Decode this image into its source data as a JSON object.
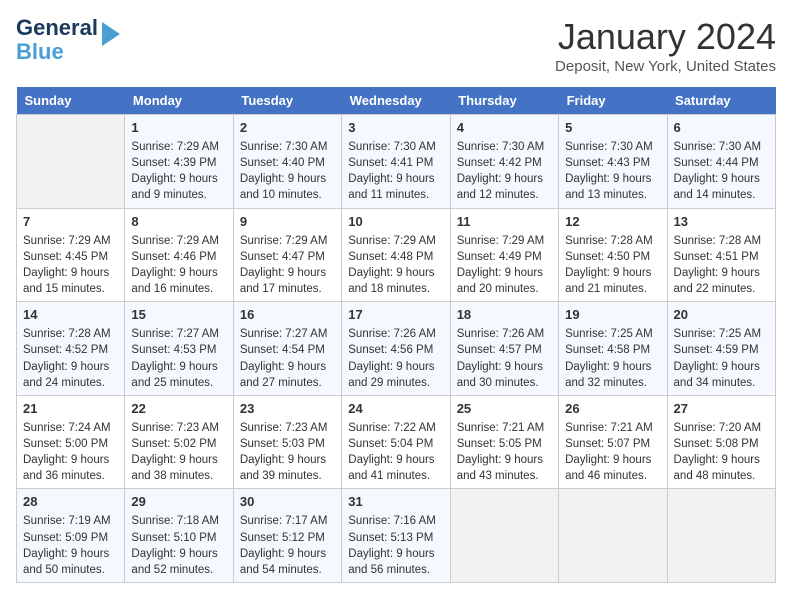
{
  "header": {
    "logo_line1": "General",
    "logo_line2": "Blue",
    "title": "January 2024",
    "subtitle": "Deposit, New York, United States"
  },
  "days_of_week": [
    "Sunday",
    "Monday",
    "Tuesday",
    "Wednesday",
    "Thursday",
    "Friday",
    "Saturday"
  ],
  "weeks": [
    [
      {
        "day": "",
        "sunrise": "",
        "sunset": "",
        "daylight": ""
      },
      {
        "day": "1",
        "sunrise": "Sunrise: 7:29 AM",
        "sunset": "Sunset: 4:39 PM",
        "daylight": "Daylight: 9 hours and 9 minutes."
      },
      {
        "day": "2",
        "sunrise": "Sunrise: 7:30 AM",
        "sunset": "Sunset: 4:40 PM",
        "daylight": "Daylight: 9 hours and 10 minutes."
      },
      {
        "day": "3",
        "sunrise": "Sunrise: 7:30 AM",
        "sunset": "Sunset: 4:41 PM",
        "daylight": "Daylight: 9 hours and 11 minutes."
      },
      {
        "day": "4",
        "sunrise": "Sunrise: 7:30 AM",
        "sunset": "Sunset: 4:42 PM",
        "daylight": "Daylight: 9 hours and 12 minutes."
      },
      {
        "day": "5",
        "sunrise": "Sunrise: 7:30 AM",
        "sunset": "Sunset: 4:43 PM",
        "daylight": "Daylight: 9 hours and 13 minutes."
      },
      {
        "day": "6",
        "sunrise": "Sunrise: 7:30 AM",
        "sunset": "Sunset: 4:44 PM",
        "daylight": "Daylight: 9 hours and 14 minutes."
      }
    ],
    [
      {
        "day": "7",
        "sunrise": "Sunrise: 7:29 AM",
        "sunset": "Sunset: 4:45 PM",
        "daylight": "Daylight: 9 hours and 15 minutes."
      },
      {
        "day": "8",
        "sunrise": "Sunrise: 7:29 AM",
        "sunset": "Sunset: 4:46 PM",
        "daylight": "Daylight: 9 hours and 16 minutes."
      },
      {
        "day": "9",
        "sunrise": "Sunrise: 7:29 AM",
        "sunset": "Sunset: 4:47 PM",
        "daylight": "Daylight: 9 hours and 17 minutes."
      },
      {
        "day": "10",
        "sunrise": "Sunrise: 7:29 AM",
        "sunset": "Sunset: 4:48 PM",
        "daylight": "Daylight: 9 hours and 18 minutes."
      },
      {
        "day": "11",
        "sunrise": "Sunrise: 7:29 AM",
        "sunset": "Sunset: 4:49 PM",
        "daylight": "Daylight: 9 hours and 20 minutes."
      },
      {
        "day": "12",
        "sunrise": "Sunrise: 7:28 AM",
        "sunset": "Sunset: 4:50 PM",
        "daylight": "Daylight: 9 hours and 21 minutes."
      },
      {
        "day": "13",
        "sunrise": "Sunrise: 7:28 AM",
        "sunset": "Sunset: 4:51 PM",
        "daylight": "Daylight: 9 hours and 22 minutes."
      }
    ],
    [
      {
        "day": "14",
        "sunrise": "Sunrise: 7:28 AM",
        "sunset": "Sunset: 4:52 PM",
        "daylight": "Daylight: 9 hours and 24 minutes."
      },
      {
        "day": "15",
        "sunrise": "Sunrise: 7:27 AM",
        "sunset": "Sunset: 4:53 PM",
        "daylight": "Daylight: 9 hours and 25 minutes."
      },
      {
        "day": "16",
        "sunrise": "Sunrise: 7:27 AM",
        "sunset": "Sunset: 4:54 PM",
        "daylight": "Daylight: 9 hours and 27 minutes."
      },
      {
        "day": "17",
        "sunrise": "Sunrise: 7:26 AM",
        "sunset": "Sunset: 4:56 PM",
        "daylight": "Daylight: 9 hours and 29 minutes."
      },
      {
        "day": "18",
        "sunrise": "Sunrise: 7:26 AM",
        "sunset": "Sunset: 4:57 PM",
        "daylight": "Daylight: 9 hours and 30 minutes."
      },
      {
        "day": "19",
        "sunrise": "Sunrise: 7:25 AM",
        "sunset": "Sunset: 4:58 PM",
        "daylight": "Daylight: 9 hours and 32 minutes."
      },
      {
        "day": "20",
        "sunrise": "Sunrise: 7:25 AM",
        "sunset": "Sunset: 4:59 PM",
        "daylight": "Daylight: 9 hours and 34 minutes."
      }
    ],
    [
      {
        "day": "21",
        "sunrise": "Sunrise: 7:24 AM",
        "sunset": "Sunset: 5:00 PM",
        "daylight": "Daylight: 9 hours and 36 minutes."
      },
      {
        "day": "22",
        "sunrise": "Sunrise: 7:23 AM",
        "sunset": "Sunset: 5:02 PM",
        "daylight": "Daylight: 9 hours and 38 minutes."
      },
      {
        "day": "23",
        "sunrise": "Sunrise: 7:23 AM",
        "sunset": "Sunset: 5:03 PM",
        "daylight": "Daylight: 9 hours and 39 minutes."
      },
      {
        "day": "24",
        "sunrise": "Sunrise: 7:22 AM",
        "sunset": "Sunset: 5:04 PM",
        "daylight": "Daylight: 9 hours and 41 minutes."
      },
      {
        "day": "25",
        "sunrise": "Sunrise: 7:21 AM",
        "sunset": "Sunset: 5:05 PM",
        "daylight": "Daylight: 9 hours and 43 minutes."
      },
      {
        "day": "26",
        "sunrise": "Sunrise: 7:21 AM",
        "sunset": "Sunset: 5:07 PM",
        "daylight": "Daylight: 9 hours and 46 minutes."
      },
      {
        "day": "27",
        "sunrise": "Sunrise: 7:20 AM",
        "sunset": "Sunset: 5:08 PM",
        "daylight": "Daylight: 9 hours and 48 minutes."
      }
    ],
    [
      {
        "day": "28",
        "sunrise": "Sunrise: 7:19 AM",
        "sunset": "Sunset: 5:09 PM",
        "daylight": "Daylight: 9 hours and 50 minutes."
      },
      {
        "day": "29",
        "sunrise": "Sunrise: 7:18 AM",
        "sunset": "Sunset: 5:10 PM",
        "daylight": "Daylight: 9 hours and 52 minutes."
      },
      {
        "day": "30",
        "sunrise": "Sunrise: 7:17 AM",
        "sunset": "Sunset: 5:12 PM",
        "daylight": "Daylight: 9 hours and 54 minutes."
      },
      {
        "day": "31",
        "sunrise": "Sunrise: 7:16 AM",
        "sunset": "Sunset: 5:13 PM",
        "daylight": "Daylight: 9 hours and 56 minutes."
      },
      {
        "day": "",
        "sunrise": "",
        "sunset": "",
        "daylight": ""
      },
      {
        "day": "",
        "sunrise": "",
        "sunset": "",
        "daylight": ""
      },
      {
        "day": "",
        "sunrise": "",
        "sunset": "",
        "daylight": ""
      }
    ]
  ]
}
